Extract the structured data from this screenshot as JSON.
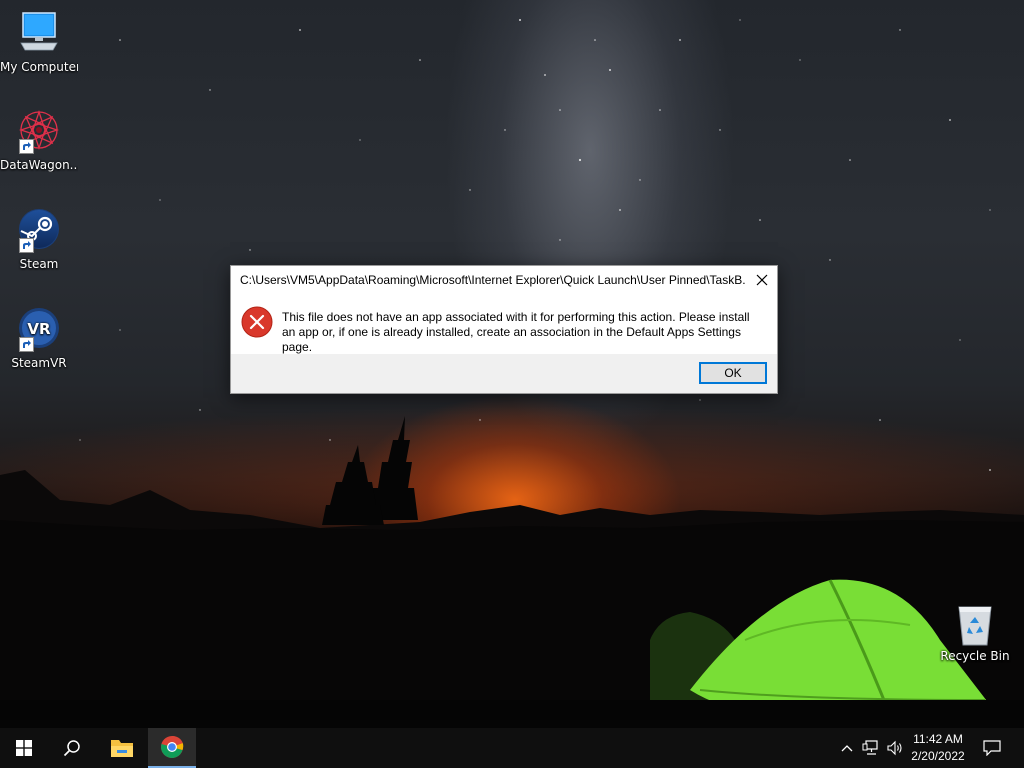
{
  "desktop": {
    "icons": [
      {
        "label": "My Computer",
        "icon": "computer-icon"
      },
      {
        "label": "DataWagon...",
        "icon": "datawagon-icon"
      },
      {
        "label": "Steam",
        "icon": "steam-icon"
      },
      {
        "label": "SteamVR",
        "icon": "steamvr-icon"
      },
      {
        "label": "Recycle Bin",
        "icon": "recycle-bin-icon"
      }
    ],
    "steamvr_badge": "VR"
  },
  "dialog": {
    "title": "C:\\Users\\VM5\\AppData\\Roaming\\Microsoft\\Internet Explorer\\Quick Launch\\User Pinned\\TaskB...",
    "message": "This file does not have an app associated with it for performing this action. Please install an app or, if one is already installed, create an association in the Default Apps Settings page.",
    "ok_label": "OK",
    "icon": "error-icon"
  },
  "taskbar": {
    "buttons": [
      "start-icon",
      "search-icon",
      "file-explorer-icon",
      "chrome-icon"
    ],
    "tray": [
      "chevron-up-icon",
      "network-icon",
      "volume-icon",
      "notification-icon"
    ],
    "time": "11:42 AM",
    "date": "2/20/2022"
  },
  "colors": {
    "accent": "#0078d7",
    "error": "#d9382b",
    "taskbar": "#0f0f0f",
    "tent": "#7fe23a"
  }
}
